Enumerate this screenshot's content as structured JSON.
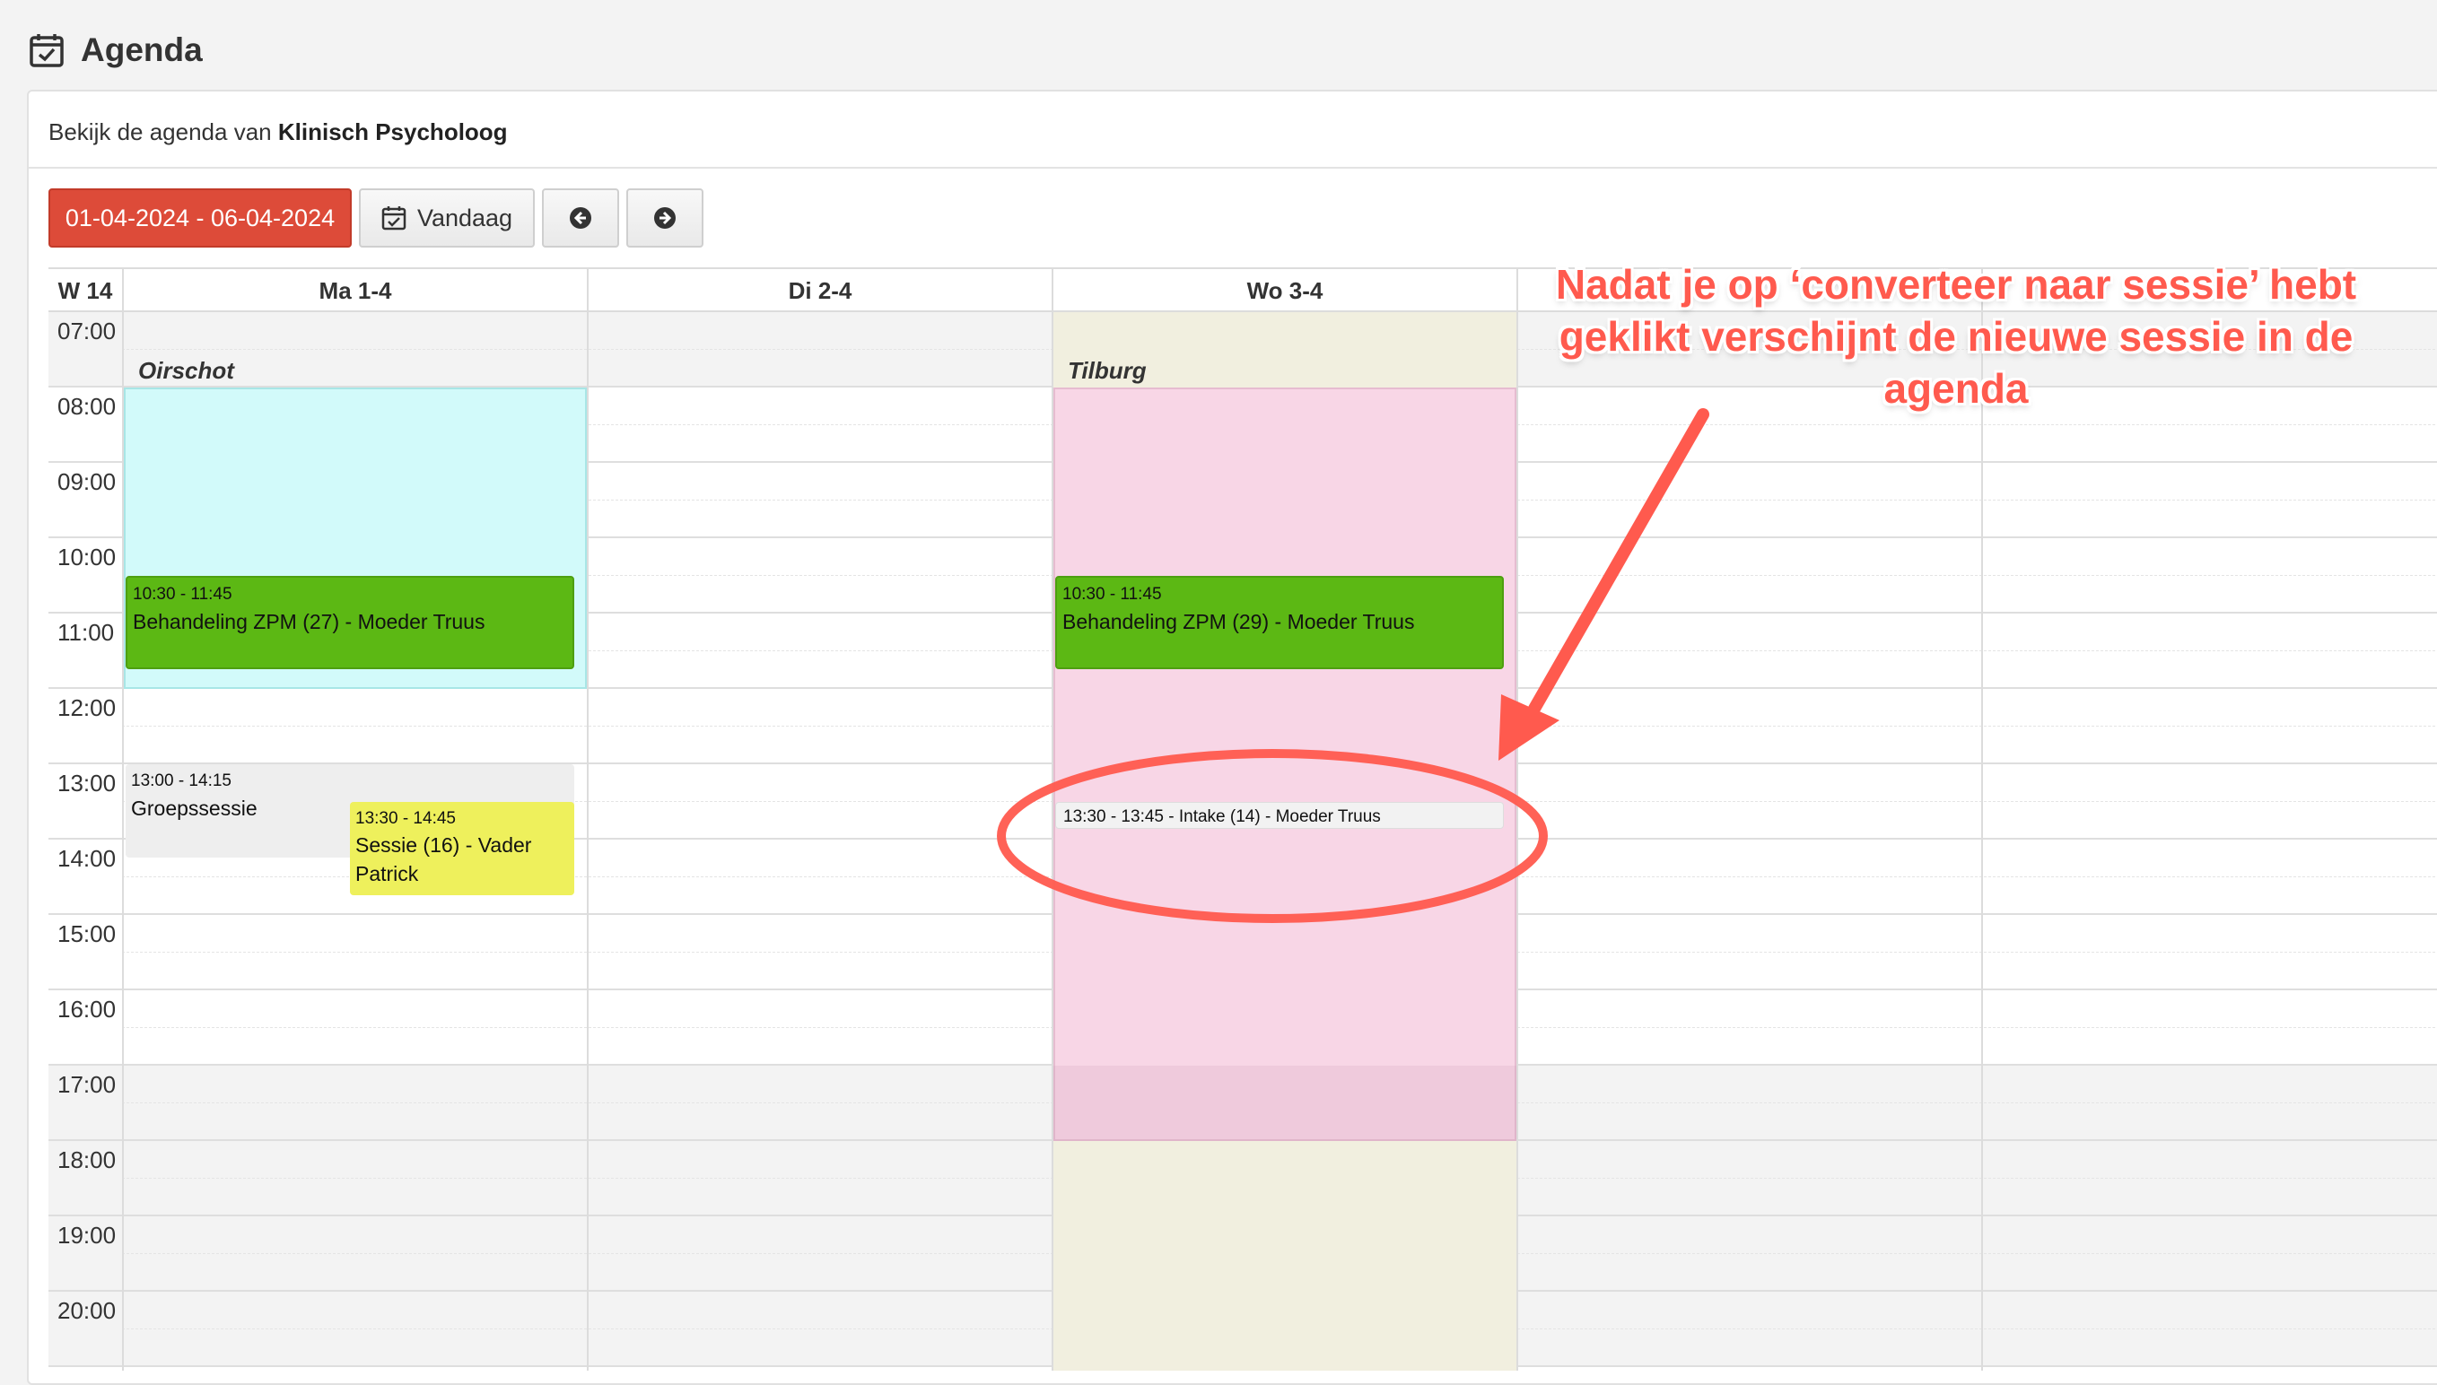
{
  "header": {
    "title": "Agenda",
    "icon": "calendar-check-icon"
  },
  "panel": {
    "subtitle_prefix": "Bekijk de agenda van",
    "subtitle_name": "Klinisch Psycholoog"
  },
  "toolbar": {
    "date_range": "01-04-2024 - 06-04-2024",
    "today_label": "Vandaag",
    "prev_icon": "arrow-left-circle-icon",
    "next_icon": "arrow-right-circle-icon"
  },
  "calendar": {
    "week_label": "W 14",
    "days": [
      "Ma 1-4",
      "Di 2-4",
      "Wo 3-4",
      "",
      ""
    ],
    "hours": [
      "07:00",
      "08:00",
      "09:00",
      "10:00",
      "11:00",
      "12:00",
      "13:00",
      "14:00",
      "15:00",
      "16:00",
      "17:00",
      "18:00",
      "19:00",
      "20:00"
    ],
    "locations": {
      "monday": "Oirschot",
      "wednesday": "Tilburg"
    },
    "events": [
      {
        "day": "Ma 1-4",
        "time": "10:30 - 11:45",
        "title": "Behandeling ZPM (27) - Moeder Truus",
        "color": "#5cb814"
      },
      {
        "day": "Ma 1-4",
        "time": "13:00 - 14:15",
        "title": "Groepssessie",
        "color": "#eeeeee"
      },
      {
        "day": "Ma 1-4",
        "time": "13:30 - 14:45",
        "title": "Sessie (16) - Vader Patrick",
        "color": "#eef05c"
      },
      {
        "day": "Wo 3-4",
        "time": "10:30 - 11:45",
        "title": "Behandeling ZPM (29) - Moeder Truus",
        "color": "#5cb814"
      },
      {
        "day": "Wo 3-4",
        "time": "",
        "title": "13:30 - 13:45 - Intake (14) - Moeder Truus",
        "color": "#f2f2f2"
      }
    ]
  },
  "annotation": {
    "text": "Nadat je op ‘converteer naar sessie’ hebt geklikt verschijnt de nieuwe sessie in de agenda",
    "color": "#ff5a4e"
  },
  "colors": {
    "accent_red": "#dd4b39",
    "location_cyan": "#d2fafa",
    "location_pink": "#f8d6e6",
    "location_beige": "#f1efdf",
    "annotation_red": "#ff5a4e"
  }
}
